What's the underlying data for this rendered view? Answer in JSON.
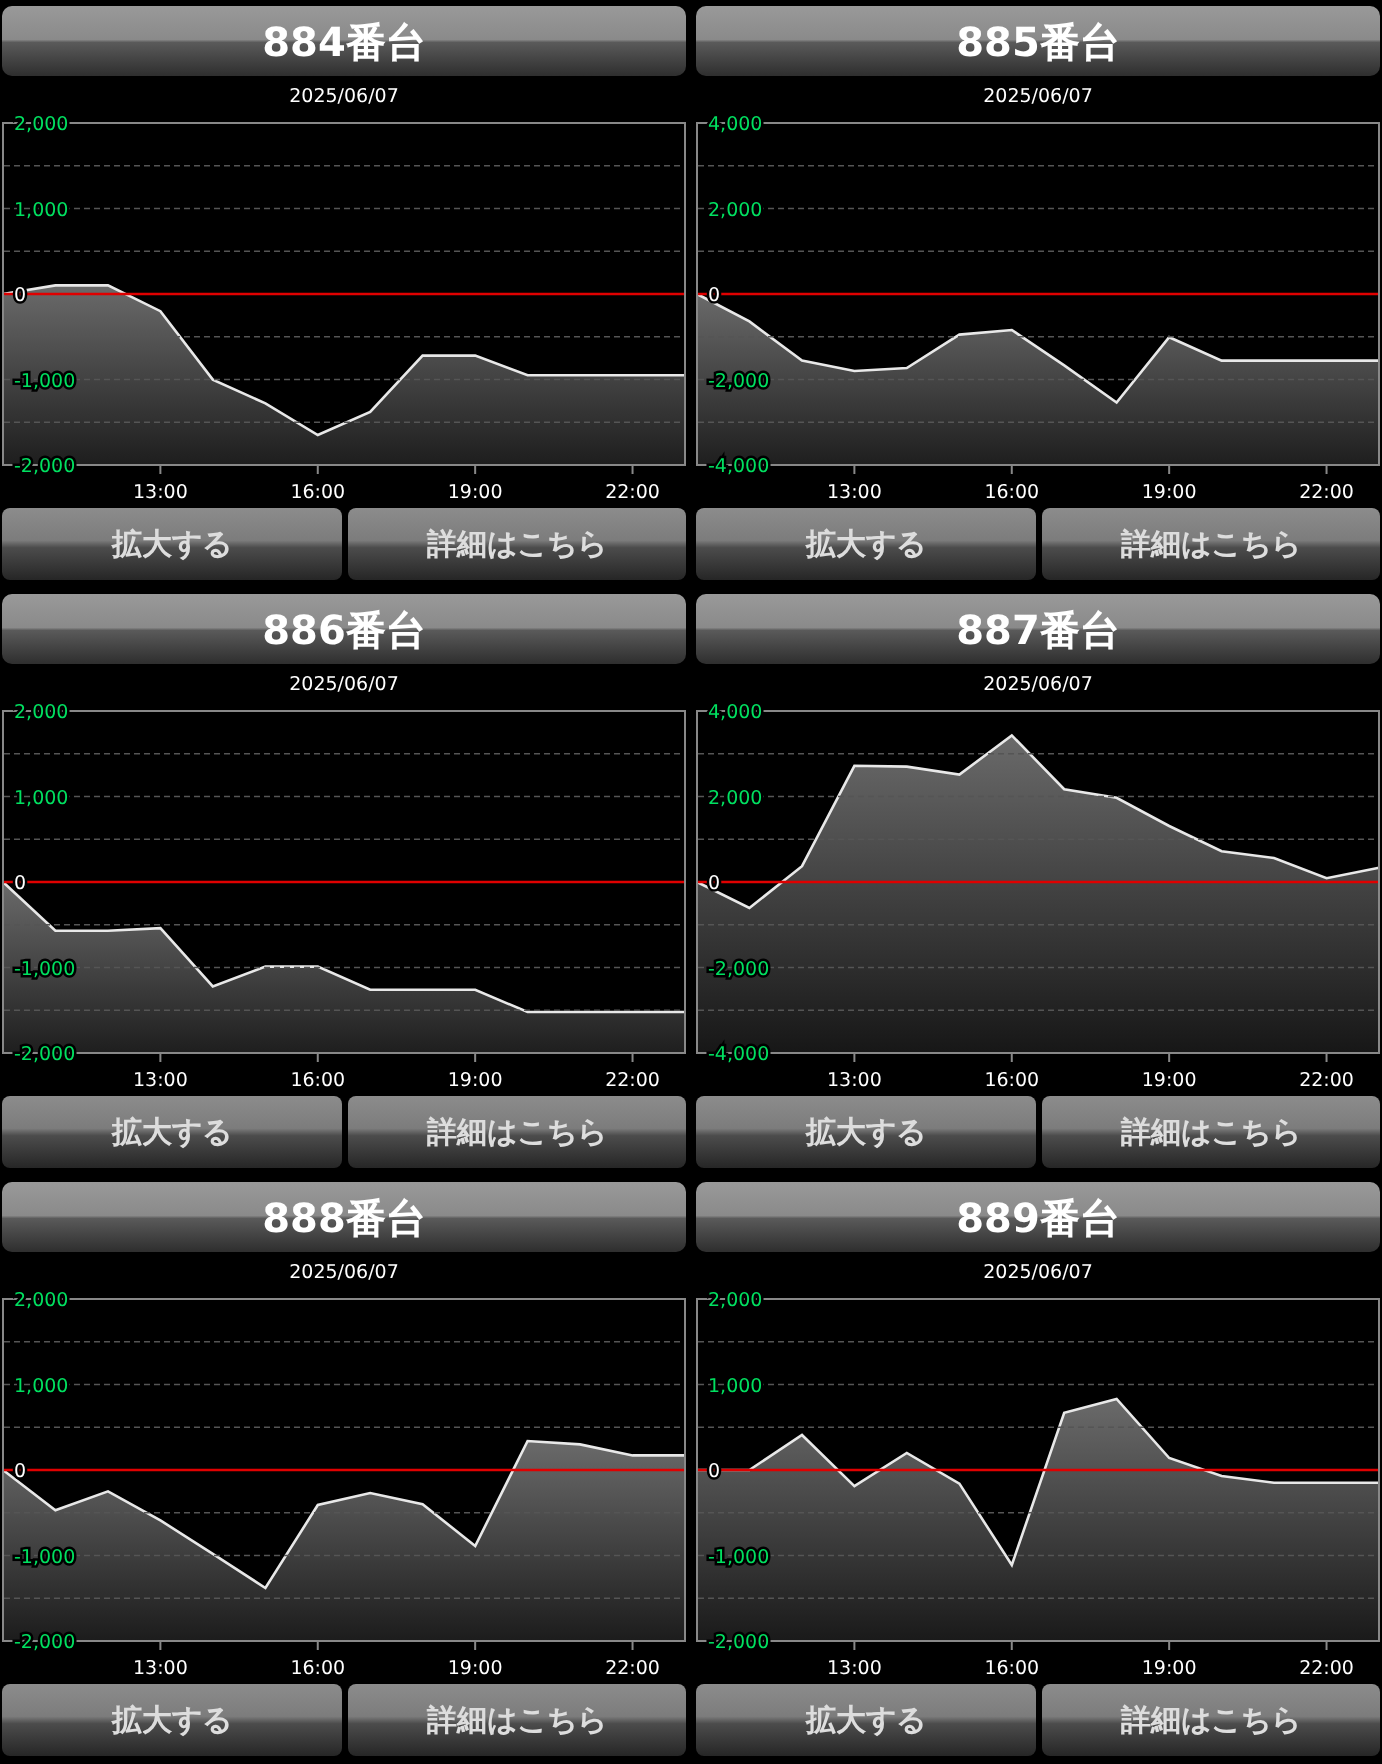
{
  "panels": [
    {
      "title": "884番台",
      "chart_data": {
        "type": "area",
        "title": "2025/06/07",
        "x": [
          10,
          11,
          12,
          13,
          14,
          15,
          16,
          17,
          18,
          19,
          20,
          21,
          22,
          23
        ],
        "xlim": [
          10,
          23
        ],
        "xticks": [
          {
            "value": 13,
            "label": "13:00"
          },
          {
            "value": 16,
            "label": "16:00"
          },
          {
            "value": 19,
            "label": "19:00"
          },
          {
            "value": 22,
            "label": "22:00"
          }
        ],
        "ylim": [
          -2000,
          2000
        ],
        "yticks": [
          {
            "value": 2000,
            "label": "2,000"
          },
          {
            "value": 1000,
            "label": "1,000"
          },
          {
            "value": 0,
            "label": "0"
          },
          {
            "value": -1000,
            "label": "-1,000"
          },
          {
            "value": -2000,
            "label": "-2,000"
          }
        ],
        "ref_lines": [
          {
            "axis": "y",
            "value": 0,
            "color": "#e00000"
          }
        ],
        "series": [
          {
            "values": [
              0,
              100,
              100,
              -200,
              -1000,
              -1280,
              -1650,
              -1380,
              -720,
              -720,
              -950,
              -950,
              -950,
              -950
            ]
          }
        ]
      },
      "buttons": [
        "拡大する",
        "詳細はこちら"
      ]
    },
    {
      "title": "885番台",
      "chart_data": {
        "type": "area",
        "title": "2025/06/07",
        "x": [
          10,
          11,
          12,
          13,
          14,
          15,
          16,
          17,
          18,
          19,
          20,
          21,
          22,
          23
        ],
        "xlim": [
          10,
          23
        ],
        "xticks": [
          {
            "value": 13,
            "label": "13:00"
          },
          {
            "value": 16,
            "label": "16:00"
          },
          {
            "value": 19,
            "label": "19:00"
          },
          {
            "value": 22,
            "label": "22:00"
          }
        ],
        "ylim": [
          -4000,
          4000
        ],
        "yticks": [
          {
            "value": 4000,
            "label": "4,000"
          },
          {
            "value": 2000,
            "label": "2,000"
          },
          {
            "value": 0,
            "label": "0"
          },
          {
            "value": -2000,
            "label": "-2,000"
          },
          {
            "value": -4000,
            "label": "-4,000"
          }
        ],
        "ref_lines": [
          {
            "axis": "y",
            "value": 0,
            "color": "#e00000"
          }
        ],
        "series": [
          {
            "values": [
              0,
              -640,
              -1560,
              -1800,
              -1730,
              -950,
              -840,
              -1670,
              -2540,
              -1010,
              -1560,
              -1560,
              -1560,
              -1560
            ]
          }
        ]
      },
      "buttons": [
        "拡大する",
        "詳細はこちら"
      ]
    },
    {
      "title": "886番台",
      "chart_data": {
        "type": "area",
        "title": "2025/06/07",
        "x": [
          10,
          11,
          12,
          13,
          14,
          15,
          16,
          17,
          18,
          19,
          20,
          21,
          22,
          23
        ],
        "xlim": [
          10,
          23
        ],
        "xticks": [
          {
            "value": 13,
            "label": "13:00"
          },
          {
            "value": 16,
            "label": "16:00"
          },
          {
            "value": 19,
            "label": "19:00"
          },
          {
            "value": 22,
            "label": "22:00"
          }
        ],
        "ylim": [
          -2000,
          2000
        ],
        "yticks": [
          {
            "value": 2000,
            "label": "2,000"
          },
          {
            "value": 1000,
            "label": "1,000"
          },
          {
            "value": 0,
            "label": "0"
          },
          {
            "value": -1000,
            "label": "-1,000"
          },
          {
            "value": -2000,
            "label": "-2,000"
          }
        ],
        "ref_lines": [
          {
            "axis": "y",
            "value": 0,
            "color": "#e00000"
          }
        ],
        "series": [
          {
            "values": [
              0,
              -570,
              -570,
              -540,
              -1220,
              -990,
              -990,
              -1260,
              -1260,
              -1260,
              -1520,
              -1520,
              -1520,
              -1520
            ]
          }
        ]
      },
      "buttons": [
        "拡大する",
        "詳細はこちら"
      ]
    },
    {
      "title": "887番台",
      "chart_data": {
        "type": "area",
        "title": "2025/06/07",
        "x": [
          10,
          11,
          12,
          13,
          14,
          15,
          16,
          17,
          18,
          19,
          20,
          21,
          22,
          23
        ],
        "xlim": [
          10,
          23
        ],
        "xticks": [
          {
            "value": 13,
            "label": "13:00"
          },
          {
            "value": 16,
            "label": "16:00"
          },
          {
            "value": 19,
            "label": "19:00"
          },
          {
            "value": 22,
            "label": "22:00"
          }
        ],
        "ylim": [
          -4000,
          4000
        ],
        "yticks": [
          {
            "value": 4000,
            "label": "4,000"
          },
          {
            "value": 2000,
            "label": "2,000"
          },
          {
            "value": 0,
            "label": "0"
          },
          {
            "value": -2000,
            "label": "-2,000"
          },
          {
            "value": -4000,
            "label": "-4,000"
          }
        ],
        "ref_lines": [
          {
            "axis": "y",
            "value": 0,
            "color": "#e00000"
          }
        ],
        "series": [
          {
            "values": [
              0,
              -610,
              370,
              2720,
              2700,
              2510,
              3430,
              2170,
              1970,
              1310,
              720,
              560,
              90,
              330
            ]
          }
        ]
      },
      "buttons": [
        "拡大する",
        "詳細はこちら"
      ]
    },
    {
      "title": "888番台",
      "chart_data": {
        "type": "area",
        "title": "2025/06/07",
        "x": [
          10,
          11,
          12,
          13,
          14,
          15,
          16,
          17,
          18,
          19,
          20,
          21,
          22,
          23
        ],
        "xlim": [
          10,
          23
        ],
        "xticks": [
          {
            "value": 13,
            "label": "13:00"
          },
          {
            "value": 16,
            "label": "16:00"
          },
          {
            "value": 19,
            "label": "19:00"
          },
          {
            "value": 22,
            "label": "22:00"
          }
        ],
        "ylim": [
          -2000,
          2000
        ],
        "yticks": [
          {
            "value": 2000,
            "label": "2,000"
          },
          {
            "value": 1000,
            "label": "1,000"
          },
          {
            "value": 0,
            "label": "0"
          },
          {
            "value": -1000,
            "label": "-1,000"
          },
          {
            "value": -2000,
            "label": "-2,000"
          }
        ],
        "ref_lines": [
          {
            "axis": "y",
            "value": 0,
            "color": "#e00000"
          }
        ],
        "series": [
          {
            "values": [
              0,
              -470,
              -250,
              -590,
              -980,
              -1380,
              -410,
              -270,
              -400,
              -890,
              340,
              300,
              170,
              170
            ]
          }
        ]
      },
      "buttons": [
        "拡大する",
        "詳細はこちら"
      ]
    },
    {
      "title": "889番台",
      "chart_data": {
        "type": "area",
        "title": "2025/06/07",
        "x": [
          10,
          11,
          12,
          13,
          14,
          15,
          16,
          17,
          18,
          19,
          20,
          21,
          22,
          23
        ],
        "xlim": [
          10,
          23
        ],
        "xticks": [
          {
            "value": 13,
            "label": "13:00"
          },
          {
            "value": 16,
            "label": "16:00"
          },
          {
            "value": 19,
            "label": "19:00"
          },
          {
            "value": 22,
            "label": "22:00"
          }
        ],
        "ylim": [
          -2000,
          2000
        ],
        "yticks": [
          {
            "value": 2000,
            "label": "2,000"
          },
          {
            "value": 1000,
            "label": "1,000"
          },
          {
            "value": 0,
            "label": "0"
          },
          {
            "value": -1000,
            "label": "-1,000"
          },
          {
            "value": -2000,
            "label": "-2,000"
          }
        ],
        "ref_lines": [
          {
            "axis": "y",
            "value": 0,
            "color": "#e00000"
          }
        ],
        "series": [
          {
            "values": [
              0,
              0,
              410,
              -190,
              200,
              -160,
              -1110,
              670,
              830,
              140,
              -70,
              -150,
              -150,
              -150
            ]
          }
        ]
      },
      "buttons": [
        "拡大する",
        "詳細はこちら"
      ]
    }
  ]
}
